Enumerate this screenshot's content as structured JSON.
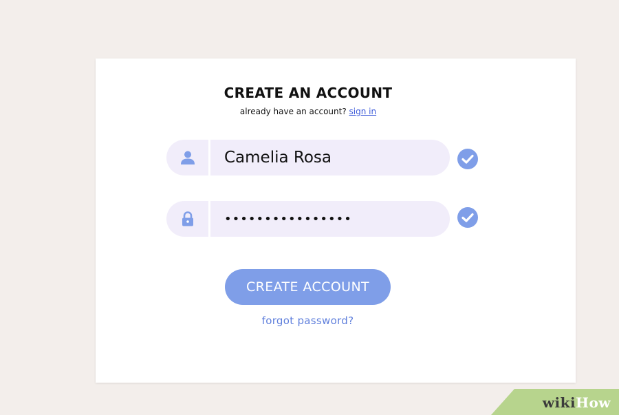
{
  "form": {
    "title": "CREATE AN ACCOUNT",
    "subtitle_prefix": "already have an account?",
    "sign_in_link": "sign in",
    "name_value": "Camelia Rosa",
    "password_value": "••••••••••••••••",
    "create_button_label": "CREATE ACCOUNT",
    "forgot_password_link": "forgot password?"
  },
  "icons": {
    "user": "user-icon",
    "lock": "lock-icon",
    "check": "check-circle-icon"
  },
  "colors": {
    "accent": "#7f9ee8",
    "field_bg": "#f1edfa",
    "link": "#3d5bd9",
    "page_bg": "#f3eeeb"
  },
  "watermark": {
    "part1": "wiki",
    "part2": "How"
  }
}
